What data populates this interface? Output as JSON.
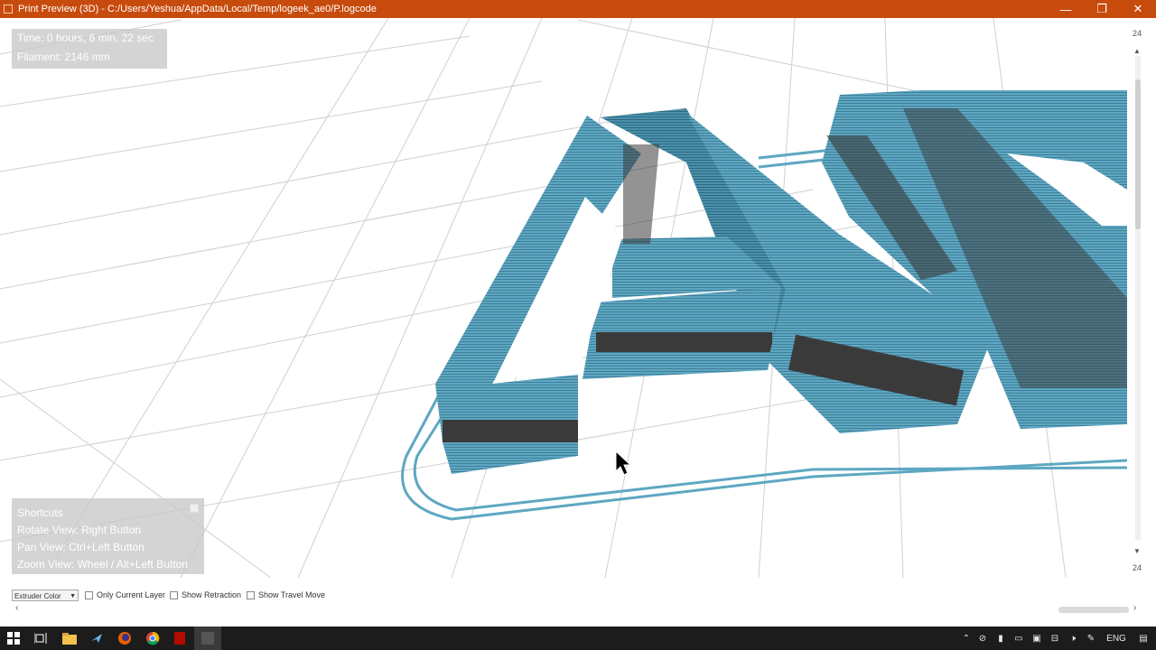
{
  "window": {
    "title": "Print Preview (3D) - C:/Users/Yeshua/AppData/Local/Temp/logeek_ae0/P.logcode",
    "minimize_glyph": "—",
    "maximize_glyph": "❐",
    "close_glyph": "✕"
  },
  "stats": {
    "time": "Time: 0 hours, 6 min, 22 sec",
    "filament": "Filament: 2146 mm"
  },
  "shortcuts": {
    "heading": "Shortcuts",
    "rotate": "Rotate View: Right Button",
    "pan": "Pan View: Ctrl+Left Button",
    "zoom": "Zoom View: Wheel / Alt+Left Button"
  },
  "layer_slider": {
    "top_value": "24",
    "bottom_value": "24"
  },
  "toolbar": {
    "color_mode": "Extruder Color",
    "only_current_layer": "Only Current Layer",
    "show_retraction": "Show Retraction",
    "show_travel_move": "Show Travel Move"
  },
  "taskbar": {
    "icons": [
      "windows-start-icon",
      "task-view-icon",
      "file-explorer-icon",
      "app-icon",
      "firefox-icon",
      "chrome-icon",
      "pdf-reader-icon",
      "active-app-icon"
    ],
    "tray_icons": [
      "chevron-up-icon",
      "antivirus-icon",
      "usb-icon",
      "battery-icon",
      "display-icon",
      "network-icon",
      "volume-mute-icon",
      "pen-icon"
    ],
    "language": "ENG"
  },
  "colors": {
    "titlebar": "#c84b0e",
    "filament": "#5ba3be",
    "filament_dark": "#3a3a3a",
    "grid": "#c8c8c8",
    "taskbar": "#1c1c1c"
  }
}
